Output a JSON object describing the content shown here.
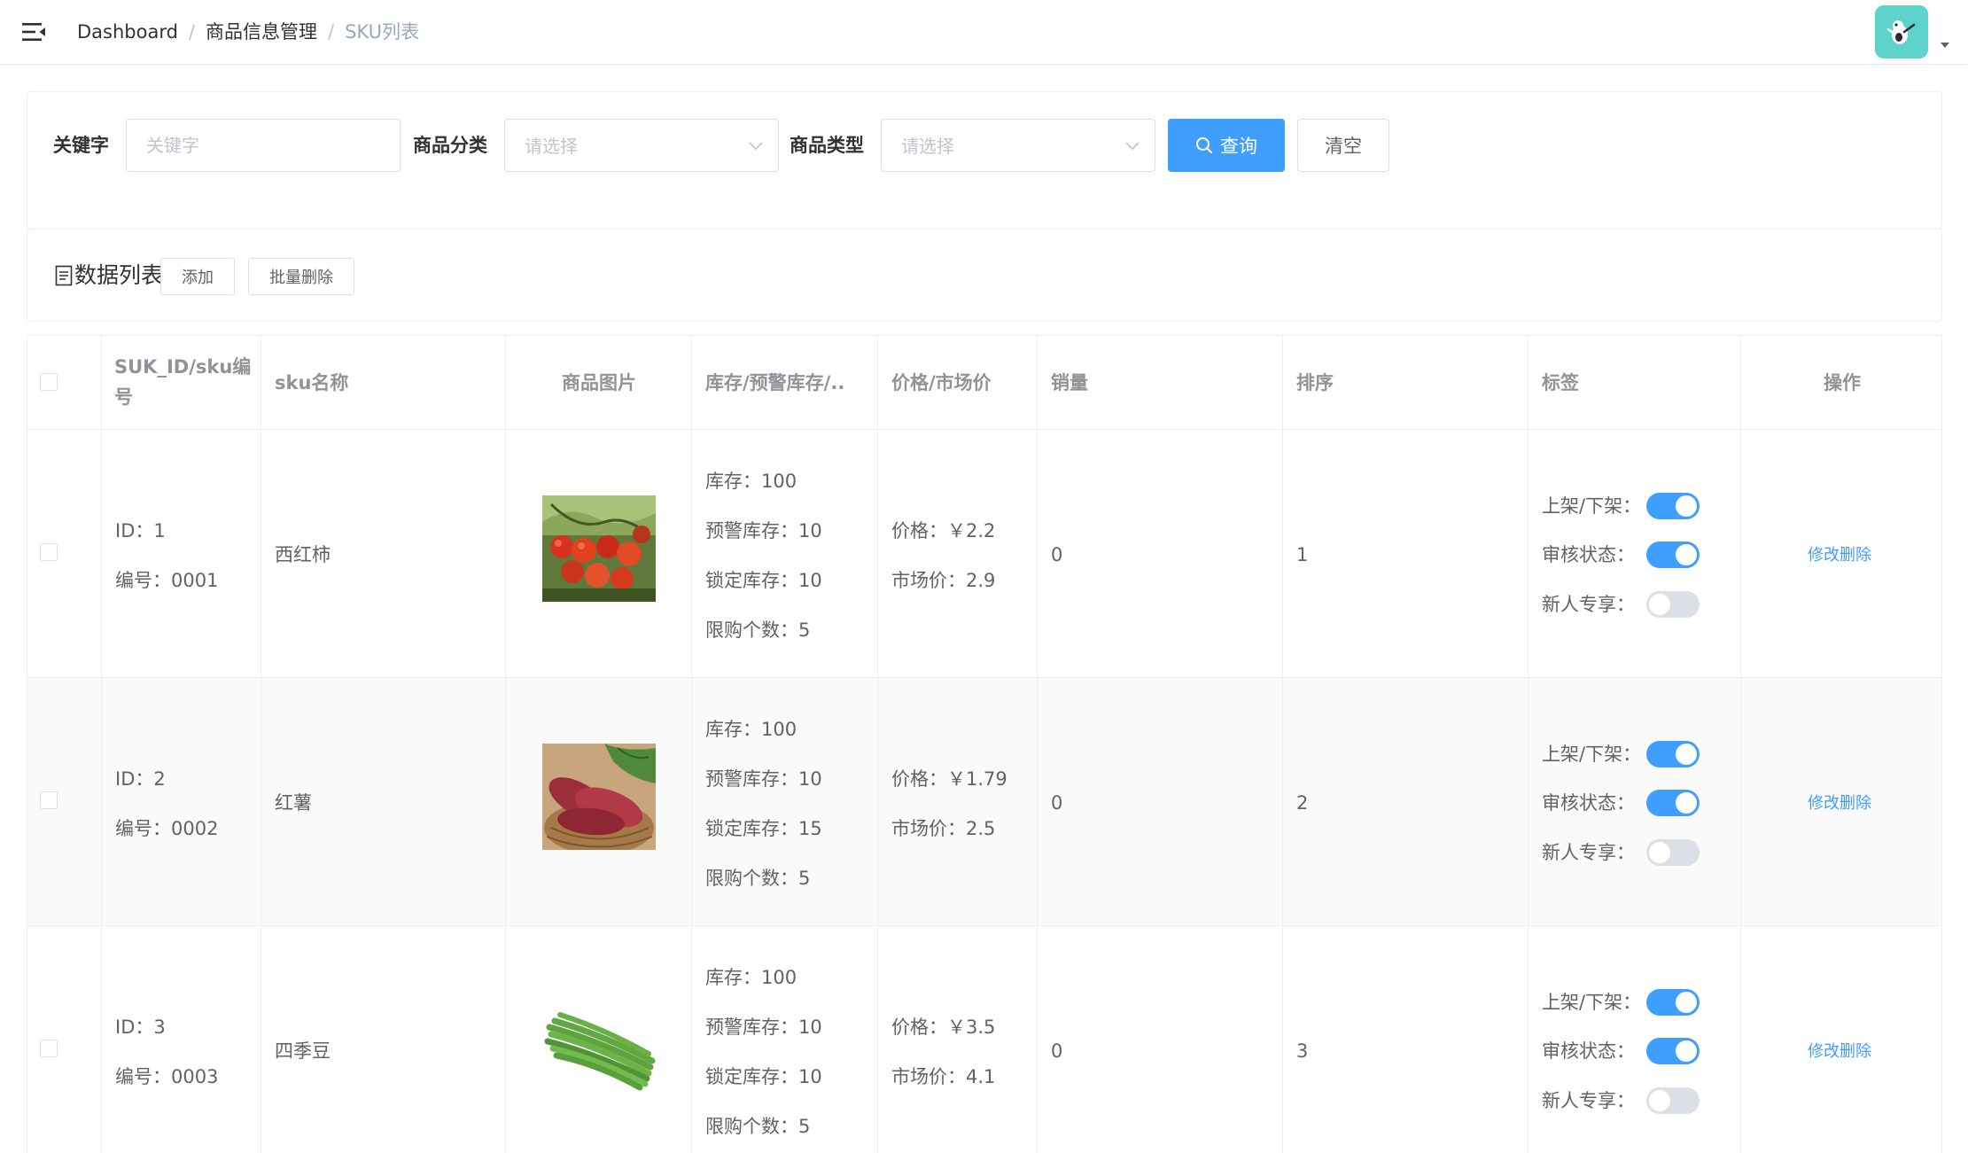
{
  "breadcrumb": {
    "items": [
      "Dashboard",
      "商品信息管理"
    ],
    "current": "SKU列表",
    "separator": "/"
  },
  "navbar": {
    "menu_icon": "hamburger-fold-icon",
    "avatar_icon": "user-avatar",
    "dropdown_icon": "caret-down-icon"
  },
  "search": {
    "keyword_label": "关键字",
    "keyword_placeholder": "关键字",
    "keyword_value": "",
    "category_label": "商品分类",
    "category_placeholder": "请选择",
    "type_label": "商品类型",
    "type_placeholder": "请选择",
    "query_button": "查询",
    "clear_button": "清空"
  },
  "list": {
    "title": "数据列表",
    "add_button": "添加",
    "batch_delete_button": "批量删除"
  },
  "table": {
    "headers": [
      "SUK_ID/sku编号",
      "sku名称",
      "商品图片",
      "库存/预警库存/..",
      "价格/市场价",
      "销量",
      "排序",
      "标签",
      "操作"
    ],
    "rows": [
      {
        "id": "ID：1",
        "code": "编号：0001",
        "name": "西红柿",
        "image": "tomato",
        "stock": "库存：100",
        "warn_stock": "预警库存：10",
        "lock_stock": "锁定库存：10",
        "limit": "限购个数：5",
        "price": "价格：￥2.2",
        "market_price": "市场价：2.9",
        "sales": "0",
        "sort": "1",
        "tag_onsale": "上架/下架：",
        "tag_onsale_on": true,
        "tag_audit": "审核状态：",
        "tag_audit_on": true,
        "tag_newuser": "新人专享：",
        "tag_newuser_on": false,
        "op_edit": "修改",
        "op_delete": "删除"
      },
      {
        "id": "ID：2",
        "code": "编号：0002",
        "name": "红薯",
        "image": "sweet-potato",
        "stock": "库存：100",
        "warn_stock": "预警库存：10",
        "lock_stock": "锁定库存：15",
        "limit": "限购个数：5",
        "price": "价格：￥1.79",
        "market_price": "市场价：2.5",
        "sales": "0",
        "sort": "2",
        "tag_onsale": "上架/下架：",
        "tag_onsale_on": true,
        "tag_audit": "审核状态：",
        "tag_audit_on": true,
        "tag_newuser": "新人专享：",
        "tag_newuser_on": false,
        "op_edit": "修改",
        "op_delete": "删除"
      },
      {
        "id": "ID：3",
        "code": "编号：0003",
        "name": "四季豆",
        "image": "green-beans",
        "stock": "库存：100",
        "warn_stock": "预警库存：10",
        "lock_stock": "锁定库存：10",
        "limit": "限购个数：5",
        "price": "价格：￥3.5",
        "market_price": "市场价：4.1",
        "sales": "0",
        "sort": "3",
        "tag_onsale": "上架/下架：",
        "tag_onsale_on": true,
        "tag_audit": "审核状态：",
        "tag_audit_on": true,
        "tag_newuser": "新人专享：",
        "tag_newuser_on": false,
        "op_edit": "修改",
        "op_delete": "删除"
      }
    ]
  },
  "colors": {
    "primary": "#409eff",
    "border": "#ebeef5",
    "text": "#606266",
    "header_text": "#909399",
    "avatar_bg": "#5ed3cb"
  }
}
